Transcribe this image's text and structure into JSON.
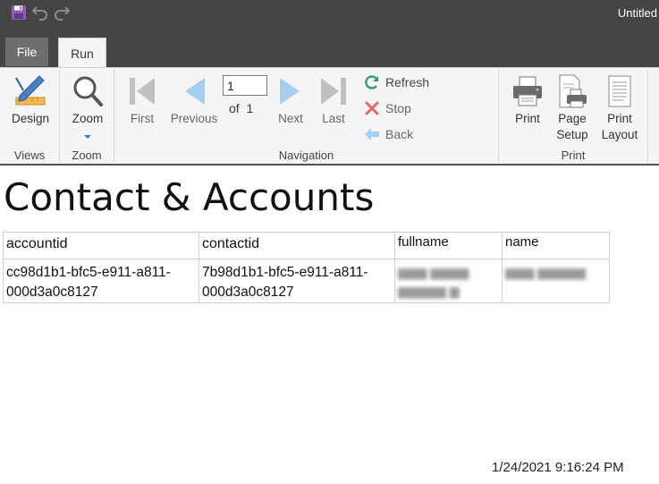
{
  "window": {
    "title": "Untitled"
  },
  "tabs": [
    {
      "label": "File"
    },
    {
      "label": "Run"
    }
  ],
  "ribbon": {
    "views": {
      "group_label": "Views",
      "design_label": "Design"
    },
    "zoom": {
      "group_label": "Zoom",
      "zoom_label": "Zoom"
    },
    "navigation": {
      "group_label": "Navigation",
      "first_label": "First",
      "previous_label": "Previous",
      "page_value": "1",
      "of_label": "of",
      "total_pages": "1",
      "next_label": "Next",
      "last_label": "Last",
      "refresh_label": "Refresh",
      "stop_label": "Stop",
      "back_label": "Back"
    },
    "print": {
      "group_label": "Print",
      "print_label": "Print",
      "page_setup_label_1": "Page",
      "page_setup_label_2": "Setup",
      "print_layout_label_1": "Print",
      "print_layout_label_2": "Layout"
    }
  },
  "report": {
    "title": "Contact & Accounts",
    "columns": [
      "accountid",
      "contactid",
      "fullname",
      "name"
    ],
    "rows": [
      {
        "accountid_1": "cc98d1b1-bfc5-e911-a811-",
        "accountid_2": "000d3a0c8127",
        "contactid_1": "7b98d1b1-bfc5-e911-a811-",
        "contactid_2": "000d3a0c8127"
      }
    ],
    "timestamp": "1/24/2021 9:16:24 PM"
  },
  "colors": {
    "titlebar": "#444444",
    "ribbon_bg": "#f5f5f5",
    "nav_icon_disabled": "#c0c0c0",
    "nav_icon_blue": "#a7cdf0",
    "refresh_green": "#3b9a7a",
    "stop_red": "#d9534f",
    "accent_purple": "#8e5db8"
  },
  "icons": {
    "save": "save-icon",
    "undo": "undo-icon",
    "redo": "redo-icon",
    "design": "design-icon",
    "zoom": "magnifier-icon",
    "first": "first-page-icon",
    "previous": "previous-page-icon",
    "next": "next-page-icon",
    "last": "last-page-icon",
    "refresh": "refresh-icon",
    "stop": "stop-icon",
    "back": "back-icon",
    "print": "printer-icon",
    "page_setup": "page-setup-icon",
    "print_layout": "print-layout-icon"
  }
}
